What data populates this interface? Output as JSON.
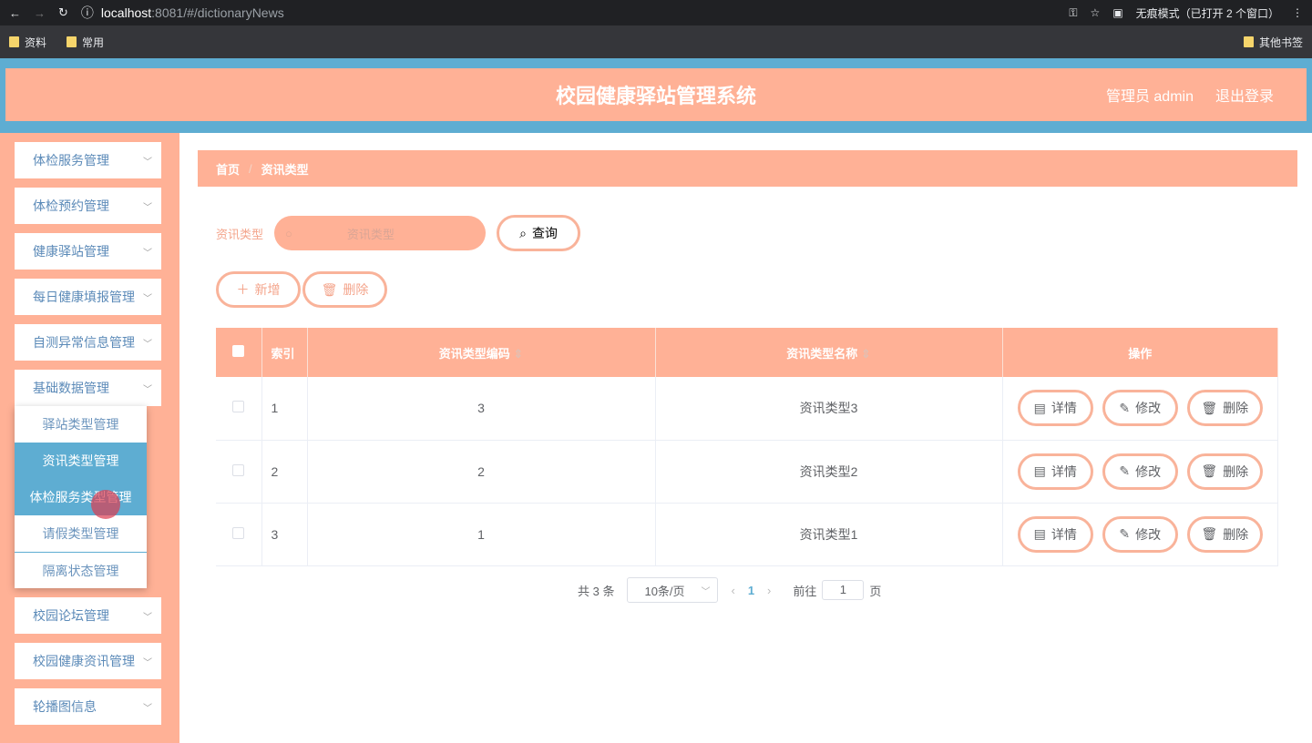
{
  "browser": {
    "url_host": "localhost",
    "url_rest": ":8081/#/dictionaryNews",
    "incognito": "无痕模式（已打开 2 个窗口）",
    "bookmarks": [
      "资料",
      "常用"
    ],
    "other_bookmarks": "其他书签"
  },
  "header": {
    "title": "校园健康驿站管理系统",
    "user": "管理员 admin",
    "logout": "退出登录"
  },
  "sidebar": {
    "menus": [
      "体检服务管理",
      "体检预约管理",
      "健康驿站管理",
      "每日健康填报管理",
      "自测异常信息管理",
      "基础数据管理"
    ],
    "submenu": [
      "驿站类型管理",
      "资讯类型管理",
      "体检服务类型管理",
      "请假类型管理",
      "隔离状态管理"
    ],
    "menus_after": [
      "校园论坛管理",
      "校园健康资讯管理",
      "轮播图信息"
    ]
  },
  "breadcrumb": {
    "home": "首页",
    "sep": "/",
    "current": "资讯类型"
  },
  "search": {
    "label": "资讯类型",
    "placeholder": "资讯类型",
    "button": "查询"
  },
  "actions": {
    "add": "新增",
    "delete": "删除"
  },
  "table": {
    "headers": [
      "索引",
      "资讯类型编码",
      "资讯类型名称",
      "操作"
    ],
    "rows": [
      {
        "index": "1",
        "code": "3",
        "name": "资讯类型3"
      },
      {
        "index": "2",
        "code": "2",
        "name": "资讯类型2"
      },
      {
        "index": "3",
        "code": "1",
        "name": "资讯类型1"
      }
    ],
    "row_actions": {
      "detail": "详情",
      "edit": "修改",
      "delete": "删除"
    }
  },
  "pagination": {
    "total": "共 3 条",
    "page_size": "10条/页",
    "current": "1",
    "goto": "前往",
    "goto_value": "1",
    "page_unit": "页"
  }
}
